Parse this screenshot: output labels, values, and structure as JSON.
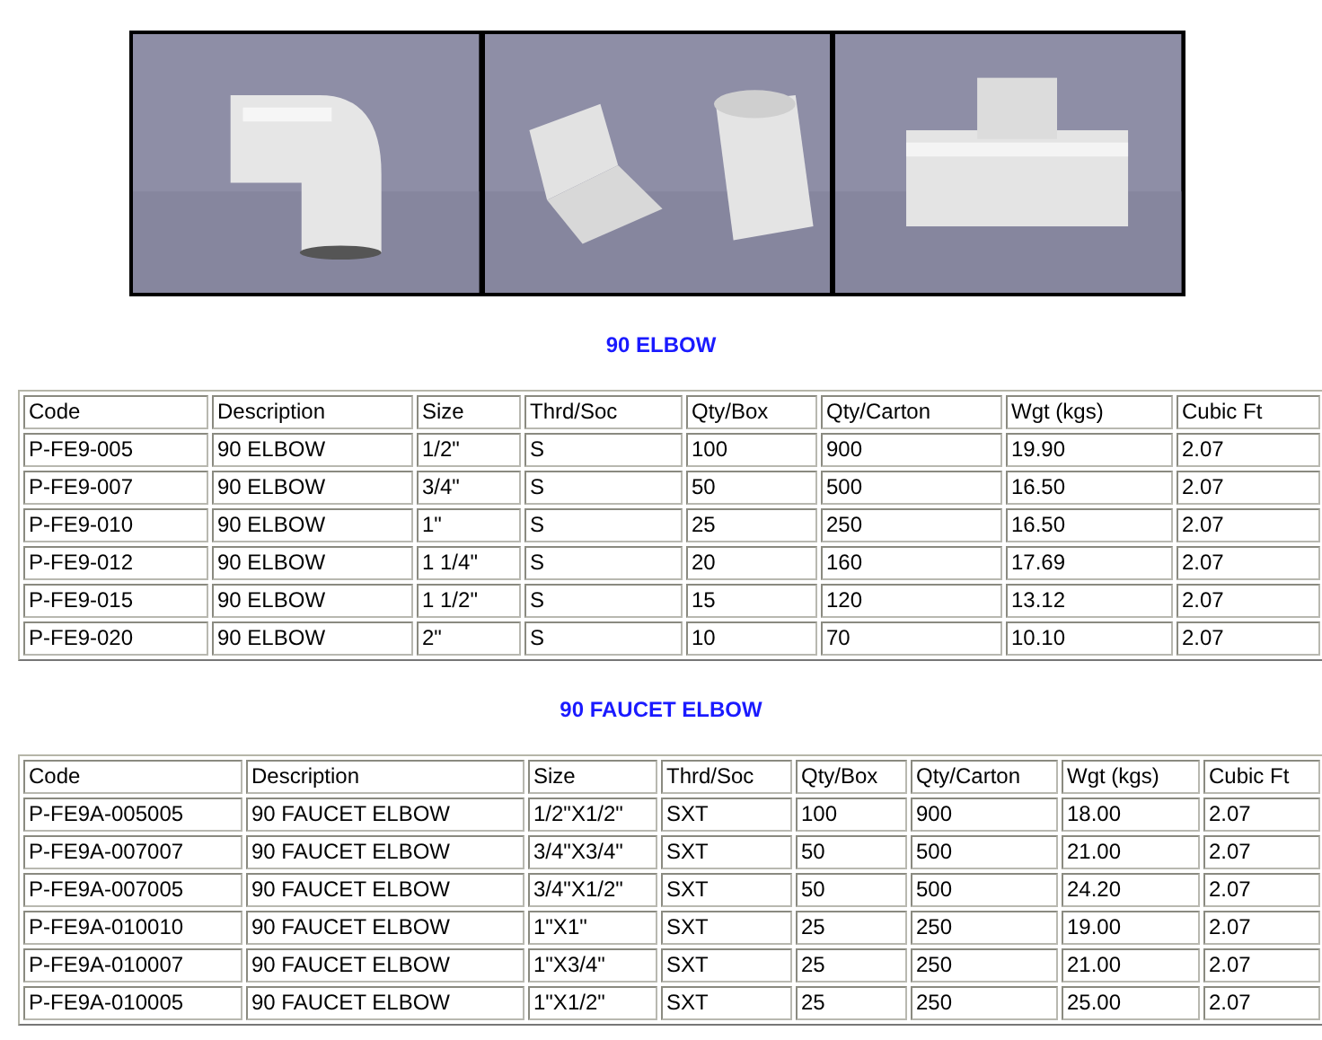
{
  "sections": [
    {
      "title": "90 ELBOW",
      "columns": [
        "Code",
        "Description",
        "Size",
        "Thrd/Soc",
        "Qty/Box",
        "Qty/Carton",
        "Wgt (kgs)",
        "Cubic Ft"
      ],
      "rows": [
        [
          "P-FE9-005",
          "90 ELBOW",
          "1/2\"",
          "S",
          "100",
          "900",
          "19.90",
          "2.07"
        ],
        [
          "P-FE9-007",
          "90 ELBOW",
          "3/4\"",
          "S",
          "50",
          "500",
          "16.50",
          "2.07"
        ],
        [
          "P-FE9-010",
          "90 ELBOW",
          "1\"",
          "S",
          "25",
          "250",
          "16.50",
          "2.07"
        ],
        [
          "P-FE9-012",
          "90 ELBOW",
          "1 1/4\"",
          "S",
          "20",
          "160",
          "17.69",
          "2.07"
        ],
        [
          "P-FE9-015",
          "90 ELBOW",
          "1 1/2\"",
          "S",
          "15",
          "120",
          "13.12",
          "2.07"
        ],
        [
          "P-FE9-020",
          "90 ELBOW",
          "2\"",
          "S",
          "10",
          "70",
          "10.10",
          "2.07"
        ]
      ]
    },
    {
      "title": "90 FAUCET ELBOW",
      "columns": [
        "Code",
        "Description",
        "Size",
        "Thrd/Soc",
        "Qty/Box",
        "Qty/Carton",
        "Wgt (kgs)",
        "Cubic Ft"
      ],
      "rows": [
        [
          "P-FE9A-005005",
          "90 FAUCET ELBOW",
          "1/2\"X1/2\"",
          "SXT",
          "100",
          "900",
          "18.00",
          "2.07"
        ],
        [
          "P-FE9A-007007",
          "90 FAUCET ELBOW",
          "3/4\"X3/4\"",
          "SXT",
          "50",
          "500",
          "21.00",
          "2.07"
        ],
        [
          "P-FE9A-007005",
          "90 FAUCET ELBOW",
          "3/4\"X1/2\"",
          "SXT",
          "50",
          "500",
          "24.20",
          "2.07"
        ],
        [
          "P-FE9A-010010",
          "90 FAUCET ELBOW",
          "1\"X1\"",
          "SXT",
          "25",
          "250",
          "19.00",
          "2.07"
        ],
        [
          "P-FE9A-010007",
          "90 FAUCET ELBOW",
          "1\"X3/4\"",
          "SXT",
          "25",
          "250",
          "21.00",
          "2.07"
        ],
        [
          "P-FE9A-010005",
          "90 FAUCET ELBOW",
          "1\"X1/2\"",
          "SXT",
          "25",
          "250",
          "25.00",
          "2.07"
        ]
      ]
    }
  ]
}
